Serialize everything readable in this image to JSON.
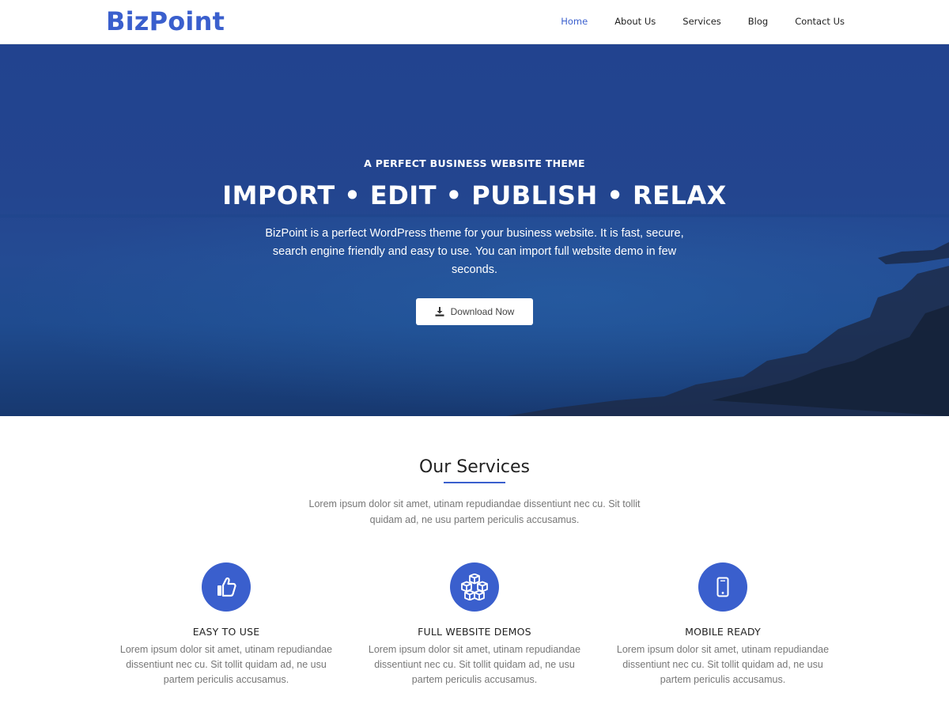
{
  "brand": {
    "logo": "BizPoint",
    "color": "#3a5fcd"
  },
  "nav": {
    "items": [
      {
        "label": "Home",
        "active": true
      },
      {
        "label": "About Us",
        "active": false
      },
      {
        "label": "Services",
        "active": false
      },
      {
        "label": "Blog",
        "active": false
      },
      {
        "label": "Contact Us",
        "active": false
      }
    ]
  },
  "hero": {
    "tagline": "A PERFECT BUSINESS WEBSITE THEME",
    "headline": "IMPORT • EDIT • PUBLISH • RELAX",
    "description": "BizPoint is a perfect WordPress theme for your business website. It is fast, secure, search engine friendly and easy to use. You can import full website demo in few seconds.",
    "button_label": "Download Now",
    "button_icon": "download-icon"
  },
  "services": {
    "heading": "Our Services",
    "intro": "Lorem ipsum dolor sit amet, utinam repudiandae dissentiunt nec cu. Sit tollit quidam ad, ne usu partem periculis accusamus.",
    "items": [
      {
        "icon": "thumbs-up-icon",
        "title": "EASY TO USE",
        "text": "Lorem ipsum dolor sit amet, utinam repudiandae dissentiunt nec cu. Sit tollit quidam ad, ne usu partem periculis accusamus."
      },
      {
        "icon": "cubes-icon",
        "title": "FULL WEBSITE DEMOS",
        "text": "Lorem ipsum dolor sit amet, utinam repudiandae dissentiunt nec cu. Sit tollit quidam ad, ne usu partem periculis accusamus."
      },
      {
        "icon": "mobile-icon",
        "title": "MOBILE READY",
        "text": "Lorem ipsum dolor sit amet, utinam repudiandae dissentiunt nec cu. Sit tollit quidam ad, ne usu partem periculis accusamus."
      }
    ]
  }
}
